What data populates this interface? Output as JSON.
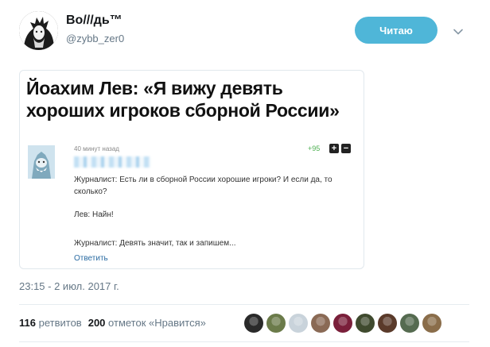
{
  "author": {
    "name": "Во///дь™",
    "handle": "@zybb_zer0"
  },
  "follow_button": {
    "label": "Читаю",
    "color": "#4fb6d8"
  },
  "embed": {
    "headline": "Йоахим Лев: «Я вижу девять хороших игроков сборной России»",
    "comment": {
      "time": "40 минут назад",
      "score": "+95",
      "vote_up": "+",
      "vote_down": "−",
      "q1": "Журналист: Есть ли в сборной России хорошие игроки? И если да, то сколько?",
      "answer": "Лев: Найн!",
      "q2": "Журналист: Девять значит, так и запишем...",
      "reply": "Ответить"
    }
  },
  "tweet": {
    "timestamp": "23:15 - 2 июл. 2017 г.",
    "retweets_count": "116",
    "retweets_label": "ретвитов",
    "likes_count": "200",
    "likes_label": "отметок «Нравится»"
  },
  "icons": {
    "caret": "chevron-down-icon"
  },
  "likers_colors": [
    "#2a2a2a",
    "#6b7b4a",
    "#c9d3db",
    "#8a6a55",
    "#7a1f3a",
    "#3f4a2e",
    "#5a3a2a",
    "#556b50",
    "#8a6d4a"
  ]
}
